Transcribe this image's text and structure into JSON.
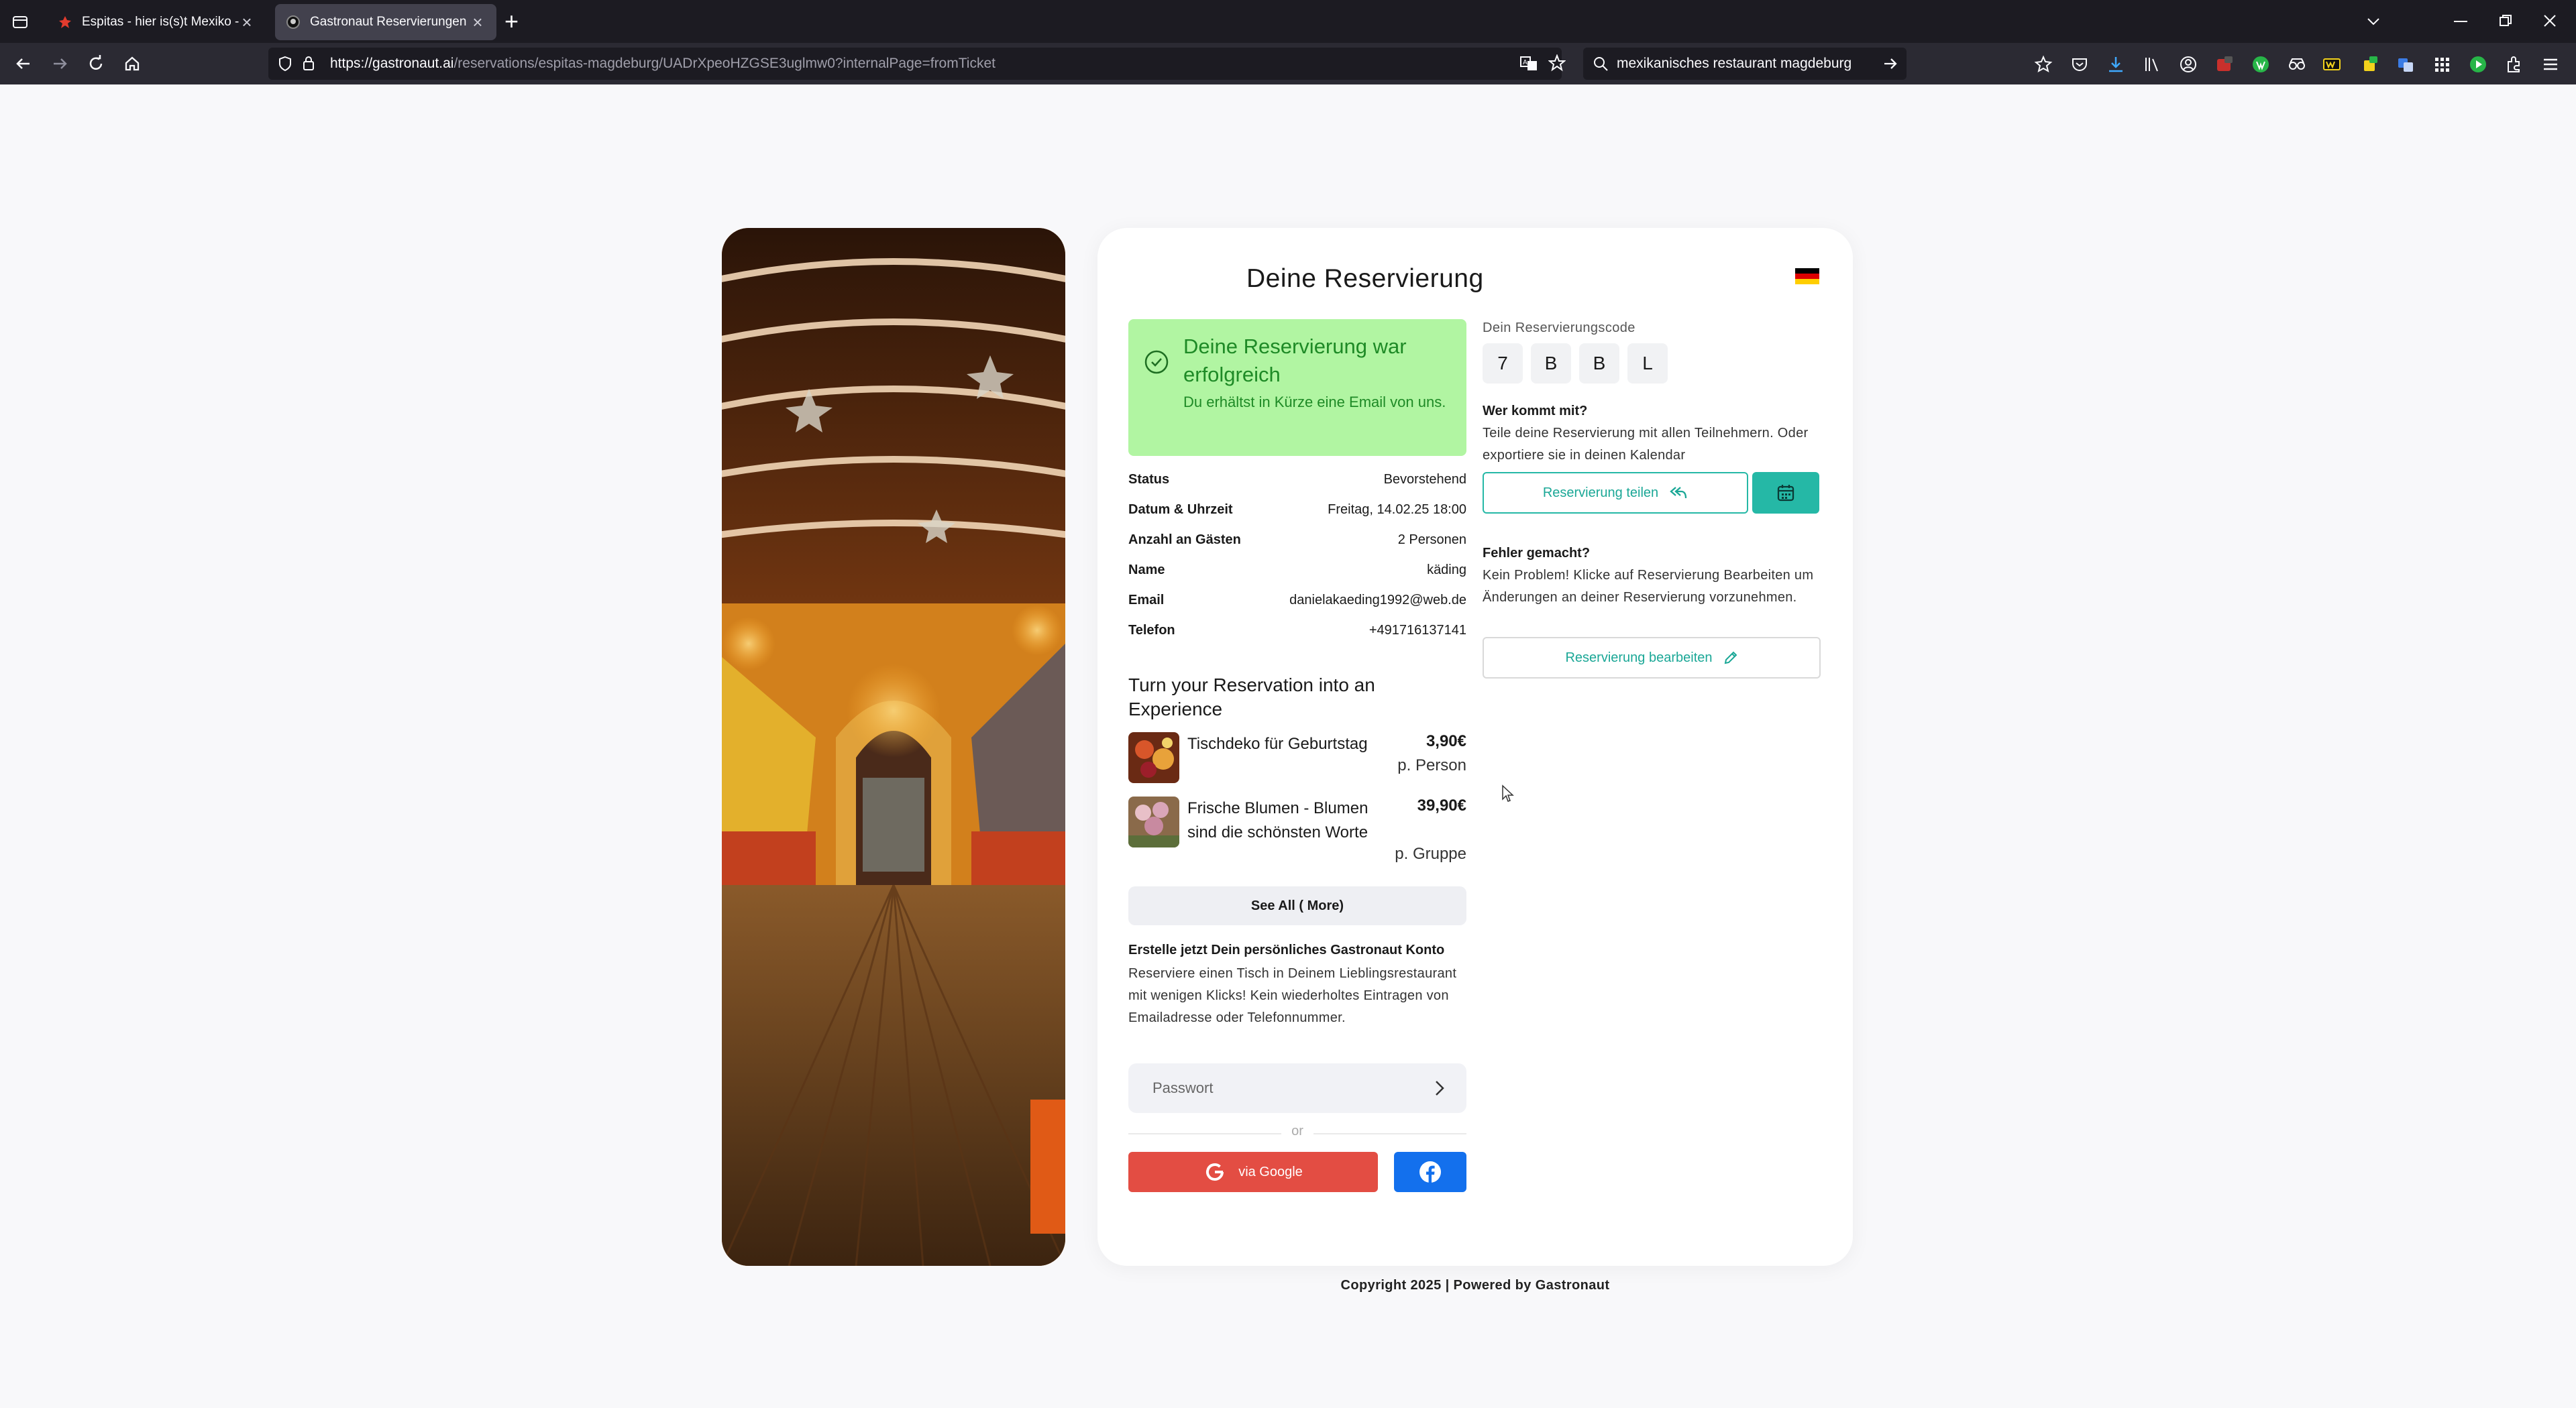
{
  "browser": {
    "tabs": [
      {
        "label": "Espitas - hier is(s)t Mexiko - Espitas",
        "active": false
      },
      {
        "label": "Gastronaut Reservierungen",
        "active": true
      }
    ],
    "url": {
      "host": "https://gastronaut.ai",
      "path": "/reservations/espitas-magdeburg/UADrXpeoHZGSE3uglmw0?internalPage=fromTicket"
    },
    "search_value": "mexikanisches restaurant magdeburg",
    "icons": [
      "tab-list-icon",
      "back-icon",
      "forward-icon",
      "reload-icon",
      "home-icon",
      "shield-icon",
      "lock-icon",
      "translate-icon",
      "star-icon",
      "search-icon",
      "go-arrow-icon",
      "library-icon",
      "account-icon",
      "extensions-icon",
      "menu-icon"
    ]
  },
  "page": {
    "title": "Deine Reservierung",
    "language_flag": "de",
    "success": {
      "title": "Deine Reservierung war erfolgreich",
      "subtitle": "Du erhältst in Kürze eine Email von uns.",
      "color": "#b1f5a2"
    },
    "details": [
      {
        "label": "Status",
        "value": "Bevorstehend"
      },
      {
        "label": "Datum & Uhrzeit",
        "value": "Freitag, 14.02.25 18:00"
      },
      {
        "label": "Anzahl an Gästen",
        "value": "2 Personen"
      },
      {
        "label": "Name",
        "value": "käding"
      },
      {
        "label": "Email",
        "value": "danielakaeding1992@web.de"
      },
      {
        "label": "Telefon",
        "value": "+491716137141"
      }
    ],
    "experience": {
      "title": "Turn your Reservation into an Experience",
      "items": [
        {
          "name": "Tischdeko für Geburtstag",
          "price": "3,90€",
          "unit": "p. Person"
        },
        {
          "name": "Frische Blumen - Blumen sind die schönsten Worte",
          "price": "39,90€",
          "unit": "p. Gruppe"
        }
      ],
      "see_all": "See All ( More)"
    },
    "account": {
      "title": "Erstelle jetzt Dein persönliches Gastronaut Konto",
      "text": "Reserviere einen Tisch in Deinem Lieblingsrestaurant mit wenigen Klicks! Kein wiederholtes Eintragen von Emailadresse oder Telefonnummer.",
      "password_placeholder": "Passwort",
      "or": "or",
      "google_label": "via Google"
    },
    "code": {
      "label": "Dein Reservierungscode",
      "chars": [
        "7",
        "B",
        "B",
        "L"
      ]
    },
    "share": {
      "title": "Wer kommt mit?",
      "text": "Teile deine Reservierung mit allen Teilnehmern. Oder exportiere sie in deinen Kalendar",
      "button": "Reservierung teilen"
    },
    "edit": {
      "title": "Fehler gemacht?",
      "text": "Kein Problem! Klicke auf Reservierung Bearbeiten um Änderungen an deiner Reservierung vorzunehmen.",
      "button": "Reservierung bearbeiten"
    },
    "footer": "Copyright 2025 | Powered by Gastronaut",
    "accent_color": "#25b8a6"
  }
}
